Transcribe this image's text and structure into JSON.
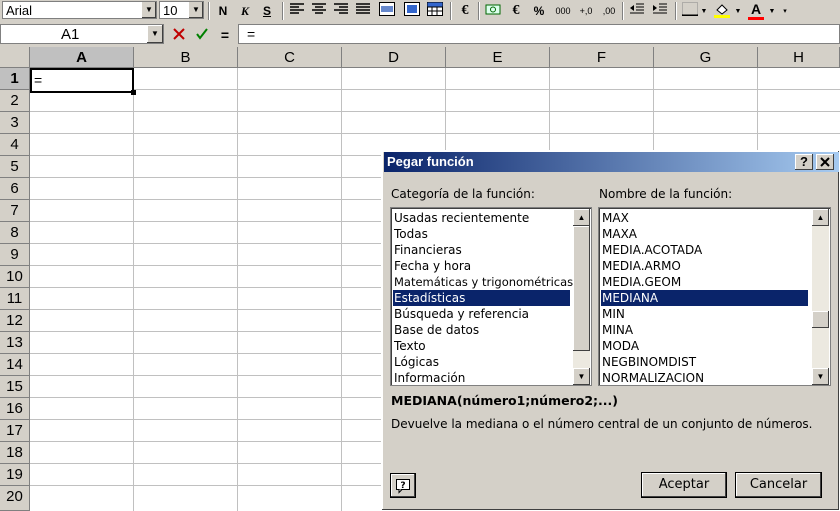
{
  "toolbar": {
    "font_name": "Arial",
    "font_size": "10",
    "bold": "N",
    "italic": "K",
    "underline": "S",
    "euro": "€",
    "percent": "%",
    "thousands": "000",
    "inc_decimal": "+,0",
    "dec_decimal": ",00",
    "font_color_letter": "A"
  },
  "formula_bar": {
    "name_box": "A1",
    "equals_button": "=",
    "content": "="
  },
  "sheet": {
    "columns": [
      "A",
      "B",
      "C",
      "D",
      "E",
      "F",
      "G",
      "H"
    ],
    "rows": [
      "1",
      "2",
      "3",
      "4",
      "5",
      "6",
      "7",
      "8",
      "9",
      "10",
      "11",
      "12",
      "13",
      "14",
      "15",
      "16",
      "17",
      "18",
      "19",
      "20"
    ],
    "active_cell_value": "="
  },
  "dialog": {
    "title": "Pegar función",
    "help_button": "?",
    "close_button": "✕",
    "category_label": "Categoría de la función:",
    "function_label": "Nombre de la función:",
    "categories": [
      "Usadas recientemente",
      "Todas",
      "Financieras",
      "Fecha y hora",
      "Matemáticas y trigonométricas",
      "Estadísticas",
      "Búsqueda y referencia",
      "Base de datos",
      "Texto",
      "Lógicas",
      "Información"
    ],
    "selected_category": "Estadísticas",
    "functions": [
      "MAX",
      "MAXA",
      "MEDIA.ACOTADA",
      "MEDIA.ARMO",
      "MEDIA.GEOM",
      "MEDIANA",
      "MIN",
      "MINA",
      "MODA",
      "NEGBINOMDIST",
      "NORMALIZACION"
    ],
    "selected_function": "MEDIANA",
    "syntax": "MEDIANA(número1;número2;...)",
    "description": "Devuelve la mediana o el número central de un conjunto de números.",
    "ok_button": "Aceptar",
    "cancel_button": "Cancelar"
  }
}
